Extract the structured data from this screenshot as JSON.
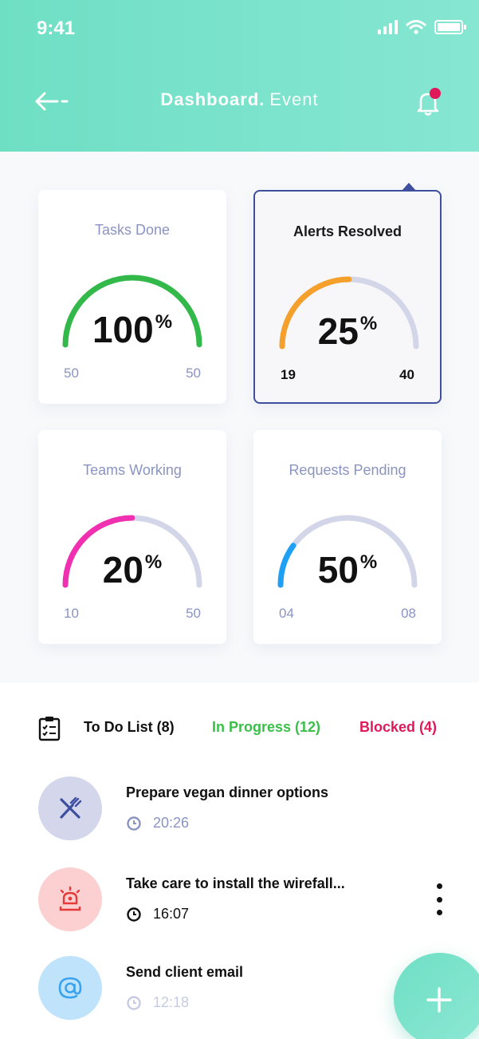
{
  "status_bar": {
    "time": "9:41"
  },
  "header": {
    "title": "Dashboard.",
    "subtitle": "Event"
  },
  "colors": {
    "header_gradient_start": "#6fdfc4",
    "header_gradient_end": "#86e6d2",
    "selected_border": "#3d4f9d",
    "label_muted": "#8a94c2",
    "gauge_track": "#d3d6e8",
    "in_progress": "#3bbf4a",
    "blocked": "#e0195a"
  },
  "cards": [
    {
      "label": "Tasks Done",
      "percent": "100",
      "percent_sign": "%",
      "min": "50",
      "max": "50",
      "progress": 1.0,
      "color": "#33b94a",
      "selected": false
    },
    {
      "label": "Alerts Resolved",
      "percent": "25",
      "percent_sign": "%",
      "min": "19",
      "max": "40",
      "progress": 0.5,
      "color": "#f5a02a",
      "selected": true
    },
    {
      "label": "Teams Working",
      "percent": "20",
      "percent_sign": "%",
      "min": "10",
      "max": "50",
      "progress": 0.5,
      "color": "#f030b0",
      "selected": false
    },
    {
      "label": "Requests Pending",
      "percent": "50",
      "percent_sign": "%",
      "min": "04",
      "max": "08",
      "progress": 0.2,
      "color": "#1ea0f5",
      "selected": false
    }
  ],
  "tabs": {
    "todo": "To Do List (8)",
    "in_progress": "In Progress (12)",
    "blocked": "Blocked (4)"
  },
  "tasks": [
    {
      "title": "Prepare vegan dinner options",
      "time": "20:26",
      "icon": "cutlery-icon",
      "avatar_color": "#d4d6ec",
      "icon_color": "#3f4fa0",
      "time_color": "#8a94c2",
      "title_color": "#111111"
    },
    {
      "title": "Take care to install the wirefall...",
      "time": "16:07",
      "icon": "alarm-light-icon",
      "avatar_color": "#fcd0d0",
      "icon_color": "#e53a3a",
      "time_color": "#111111",
      "title_color": "#111111"
    },
    {
      "title": "Send client email",
      "time": "12:18",
      "icon": "at-sign-icon",
      "avatar_color": "#bfe3fb",
      "icon_color": "#3aa2ee",
      "time_color": "#c6cbe2",
      "title_color": "#111111"
    }
  ]
}
